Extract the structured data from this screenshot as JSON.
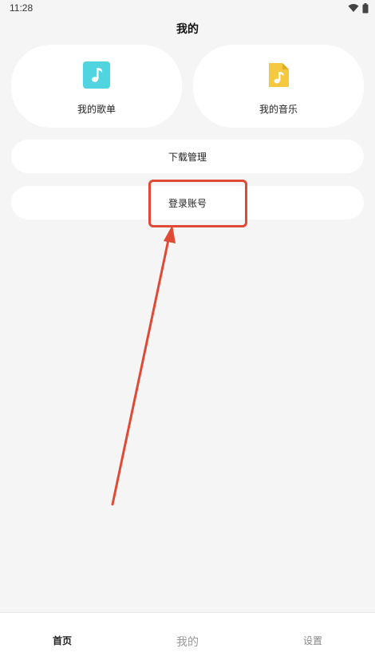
{
  "status_bar": {
    "time": "11:28",
    "icons": [
      "wifi-icon",
      "battery-icon"
    ]
  },
  "header": {
    "title": "我的"
  },
  "cards": [
    {
      "label": "我的歌单",
      "icon": "music-note-icon",
      "color": "#4fd4e0"
    },
    {
      "label": "我的音乐",
      "icon": "music-file-icon",
      "color": "#f5c842"
    }
  ],
  "menu": {
    "download_label": "下载管理",
    "login_label": "登录账号"
  },
  "annotation": {
    "color": "#e04a35"
  },
  "bottom_nav": {
    "items": [
      {
        "label": "首页"
      },
      {
        "label": "我的"
      },
      {
        "label": "设置"
      }
    ]
  }
}
